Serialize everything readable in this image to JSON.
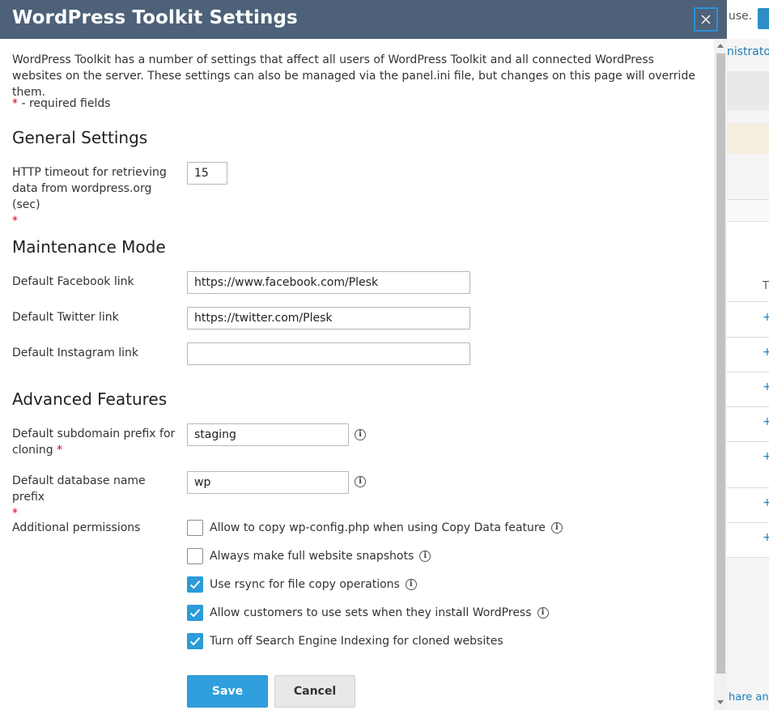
{
  "background": {
    "top_text": "use.",
    "link_text": "nistrator",
    "table_header_text": "T",
    "plus_symbol": "+",
    "footer_text": "hare an O"
  },
  "modal": {
    "title": "WordPress Toolkit Settings",
    "close_symbol": "✕",
    "intro": "WordPress Toolkit has a number of settings that affect all users of WordPress Toolkit and all connected WordPress websites on the server. These settings can also be managed via the panel.ini file, but changes on this page will override them.",
    "required_star": "*",
    "required_note": " - required fields",
    "info_symbol": "i"
  },
  "general": {
    "title": "General Settings",
    "http_timeout_label": "HTTP timeout for retrieving data from wordpress.org (sec)",
    "http_timeout_value": "15"
  },
  "maintenance": {
    "title": "Maintenance Mode",
    "facebook_label": "Default Facebook link",
    "facebook_value": "https://www.facebook.com/Plesk",
    "twitter_label": "Default Twitter link",
    "twitter_value": "https://twitter.com/Plesk",
    "instagram_label": "Default Instagram link",
    "instagram_value": ""
  },
  "advanced": {
    "title": "Advanced Features",
    "subdomain_label": "Default subdomain prefix for cloning",
    "subdomain_value": "staging",
    "dbprefix_label": "Default database name prefix",
    "dbprefix_value": "wp",
    "permissions_label": "Additional permissions",
    "permissions": [
      {
        "label": "Allow to copy wp-config.php when using Copy Data feature",
        "checked": false,
        "info": true
      },
      {
        "label": "Always make full website snapshots",
        "checked": false,
        "info": true
      },
      {
        "label": "Use rsync for file copy operations",
        "checked": true,
        "info": true
      },
      {
        "label": "Allow customers to use sets when they install WordPress",
        "checked": true,
        "info": true
      },
      {
        "label": "Turn off Search Engine Indexing for cloned websites",
        "checked": true,
        "info": false
      }
    ]
  },
  "buttons": {
    "save": "Save",
    "cancel": "Cancel"
  },
  "colors": {
    "header_bg": "#4d6279",
    "accent": "#2f9fdd",
    "required": "#d0021b"
  }
}
